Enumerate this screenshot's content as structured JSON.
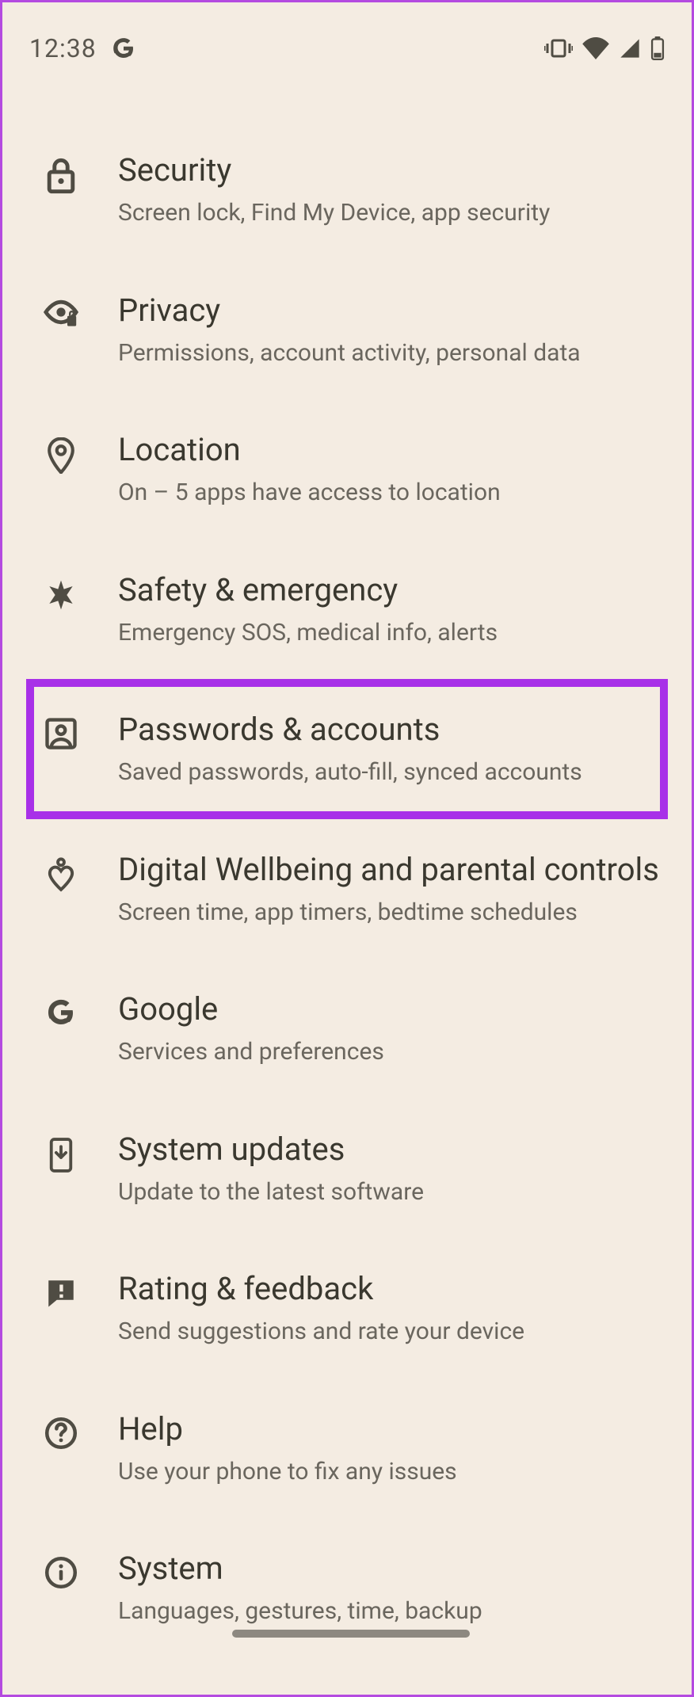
{
  "status": {
    "time": "12:38"
  },
  "highlightedKey": "passwords",
  "items": [
    {
      "key": "security",
      "title": "Security",
      "subtitle": "Screen lock, Find My Device, app security",
      "icon": "lock-icon"
    },
    {
      "key": "privacy",
      "title": "Privacy",
      "subtitle": "Permissions, account activity, personal data",
      "icon": "privacy-eye-icon"
    },
    {
      "key": "location",
      "title": "Location",
      "subtitle": "On – 5 apps have access to location",
      "icon": "location-pin-icon"
    },
    {
      "key": "safety",
      "title": "Safety & emergency",
      "subtitle": "Emergency SOS, medical info, alerts",
      "icon": "medical-star-icon"
    },
    {
      "key": "passwords",
      "title": "Passwords & accounts",
      "subtitle": "Saved passwords, auto-fill, synced accounts",
      "icon": "account-box-icon"
    },
    {
      "key": "wellbeing",
      "title": "Digital Wellbeing and parental controls",
      "subtitle": "Screen time, app timers, bedtime schedules",
      "icon": "wellbeing-heart-icon"
    },
    {
      "key": "google",
      "title": "Google",
      "subtitle": "Services and preferences",
      "icon": "google-g-icon"
    },
    {
      "key": "updates",
      "title": "System updates",
      "subtitle": "Update to the latest software",
      "icon": "phone-download-icon"
    },
    {
      "key": "rating",
      "title": "Rating & feedback",
      "subtitle": "Send suggestions and rate your device",
      "icon": "feedback-bubble-icon"
    },
    {
      "key": "help",
      "title": "Help",
      "subtitle": "Use your phone to fix any issues",
      "icon": "help-circle-icon"
    },
    {
      "key": "system",
      "title": "System",
      "subtitle": "Languages, gestures, time, backup",
      "icon": "info-circle-icon"
    }
  ]
}
